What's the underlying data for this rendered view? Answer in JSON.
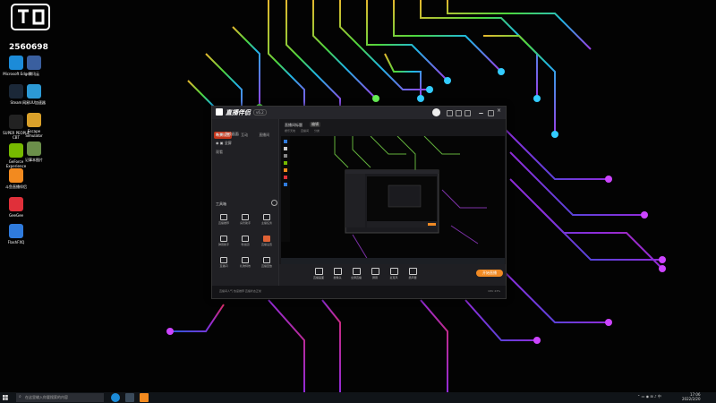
{
  "overlay": {
    "viewer_count": "2560698"
  },
  "desktop_icons": [
    {
      "label": "Microsoft Edge",
      "icon": "edge-icon",
      "color": "#1c8bd8"
    },
    {
      "label": "Steam",
      "icon": "steam-icon",
      "color": "#1b2838"
    },
    {
      "label": "SUPER PEOPLE CBT",
      "icon": "game-icon",
      "color": "#222"
    },
    {
      "label": "GeForce Experience",
      "icon": "nvidia-icon",
      "color": "#76b900"
    },
    {
      "label": "斗鱼直播伴侣",
      "icon": "douyu-icon",
      "color": "#f28a1f"
    },
    {
      "label": "GeeGee",
      "icon": "geegee-icon",
      "color": "#e0303a"
    },
    {
      "label": "FlashFXQ",
      "icon": "flash-icon",
      "color": "#2f7bdd"
    },
    {
      "label": "腾讯云",
      "icon": "app-icon",
      "color": "#3a5f9f"
    },
    {
      "label": "网易UU加速器",
      "icon": "uu-icon",
      "color": "#2c9ad6"
    },
    {
      "label": "Escape Simulator",
      "icon": "escape-icon",
      "color": "#d9a02a"
    },
    {
      "label": "记事本图片",
      "icon": "image-icon",
      "color": "#6b8f4a"
    }
  ],
  "app": {
    "brand": "直播伴侣",
    "version": "v6.2",
    "tabs": [
      "场景设置",
      "互动",
      "直播间",
      "观看"
    ],
    "scenes": [
      "游戏画面",
      "全屏"
    ],
    "room_title": "直播间标题",
    "edit_label": "编辑",
    "categories": [
      "娱乐天地",
      "直播间",
      "分类"
    ],
    "tools_title": "工具箱",
    "tools": [
      {
        "label": "直播推荐",
        "icon": "rec-icon"
      },
      {
        "label": "房管助手",
        "icon": "admin-icon"
      },
      {
        "label": "主播任务",
        "icon": "task-icon"
      },
      {
        "label": "弹幕助手",
        "icon": "barrage-icon"
      },
      {
        "label": "粉丝团",
        "icon": "fans-icon"
      },
      {
        "label": "直播设置",
        "icon": "setting-icon"
      },
      {
        "label": "直播间",
        "icon": "room-icon"
      },
      {
        "label": "礼物特效",
        "icon": "gift-icon"
      },
      {
        "label": "直播回放",
        "icon": "replay-icon"
      }
    ],
    "bottom_tools": [
      "直播画面",
      "摄像头",
      "全屏直播",
      "屏幕",
      "麦克风",
      "扬声器"
    ],
    "start_label": "开始直播",
    "status_left": "直播间人气 热度推荐 直播状态正常",
    "status_right": "CPU 23%"
  },
  "taskbar": {
    "search_placeholder": "在这里输入你要搜索的内容",
    "time": "17:06",
    "date": "2022/2/20"
  }
}
